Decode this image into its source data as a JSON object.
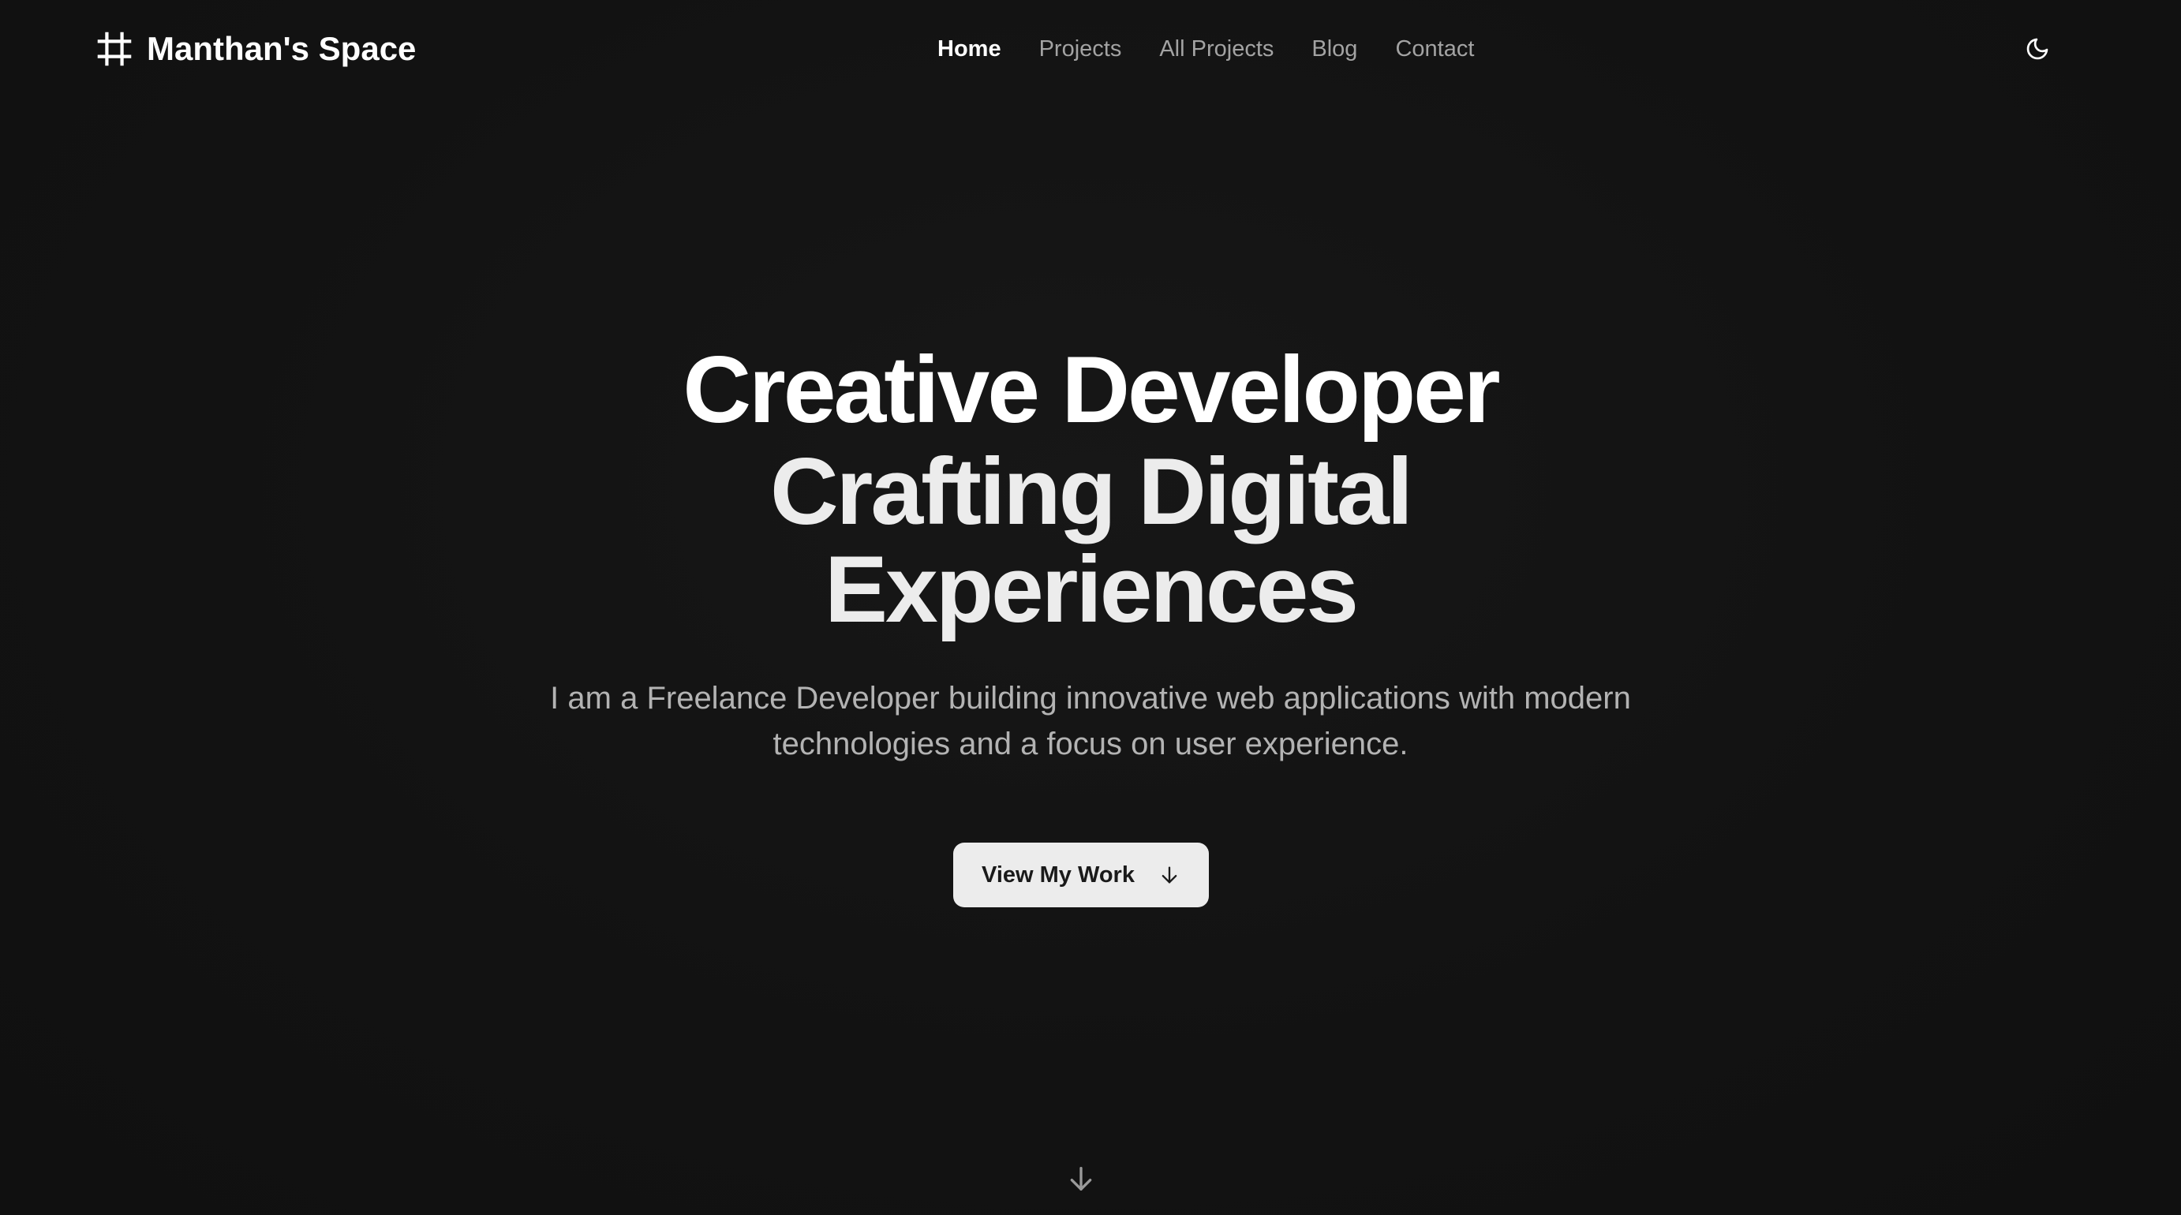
{
  "header": {
    "brand": {
      "name": "Manthan's Space",
      "icon": "hash-frame-icon"
    },
    "nav": [
      {
        "label": "Home",
        "active": true
      },
      {
        "label": "Projects",
        "active": false
      },
      {
        "label": "All Projects",
        "active": false
      },
      {
        "label": "Blog",
        "active": false
      },
      {
        "label": "Contact",
        "active": false
      }
    ],
    "theme_toggle": {
      "icon": "moon-icon"
    }
  },
  "hero": {
    "title_line1": "Creative Developer",
    "title_line2": "Crafting Digital",
    "title_line3": "Experiences",
    "subtitle": "I am a Freelance Developer building innovative web applications with modern technologies and a focus on user experience.",
    "cta": {
      "label": "View My Work",
      "icon": "arrow-down-icon"
    },
    "scroll_indicator": {
      "icon": "arrow-down-icon"
    }
  },
  "colors": {
    "background": "#131313",
    "text_primary": "#ffffff",
    "text_muted": "#a3a3a3",
    "button_bg": "#ececec",
    "button_text": "#1a1a1a"
  }
}
